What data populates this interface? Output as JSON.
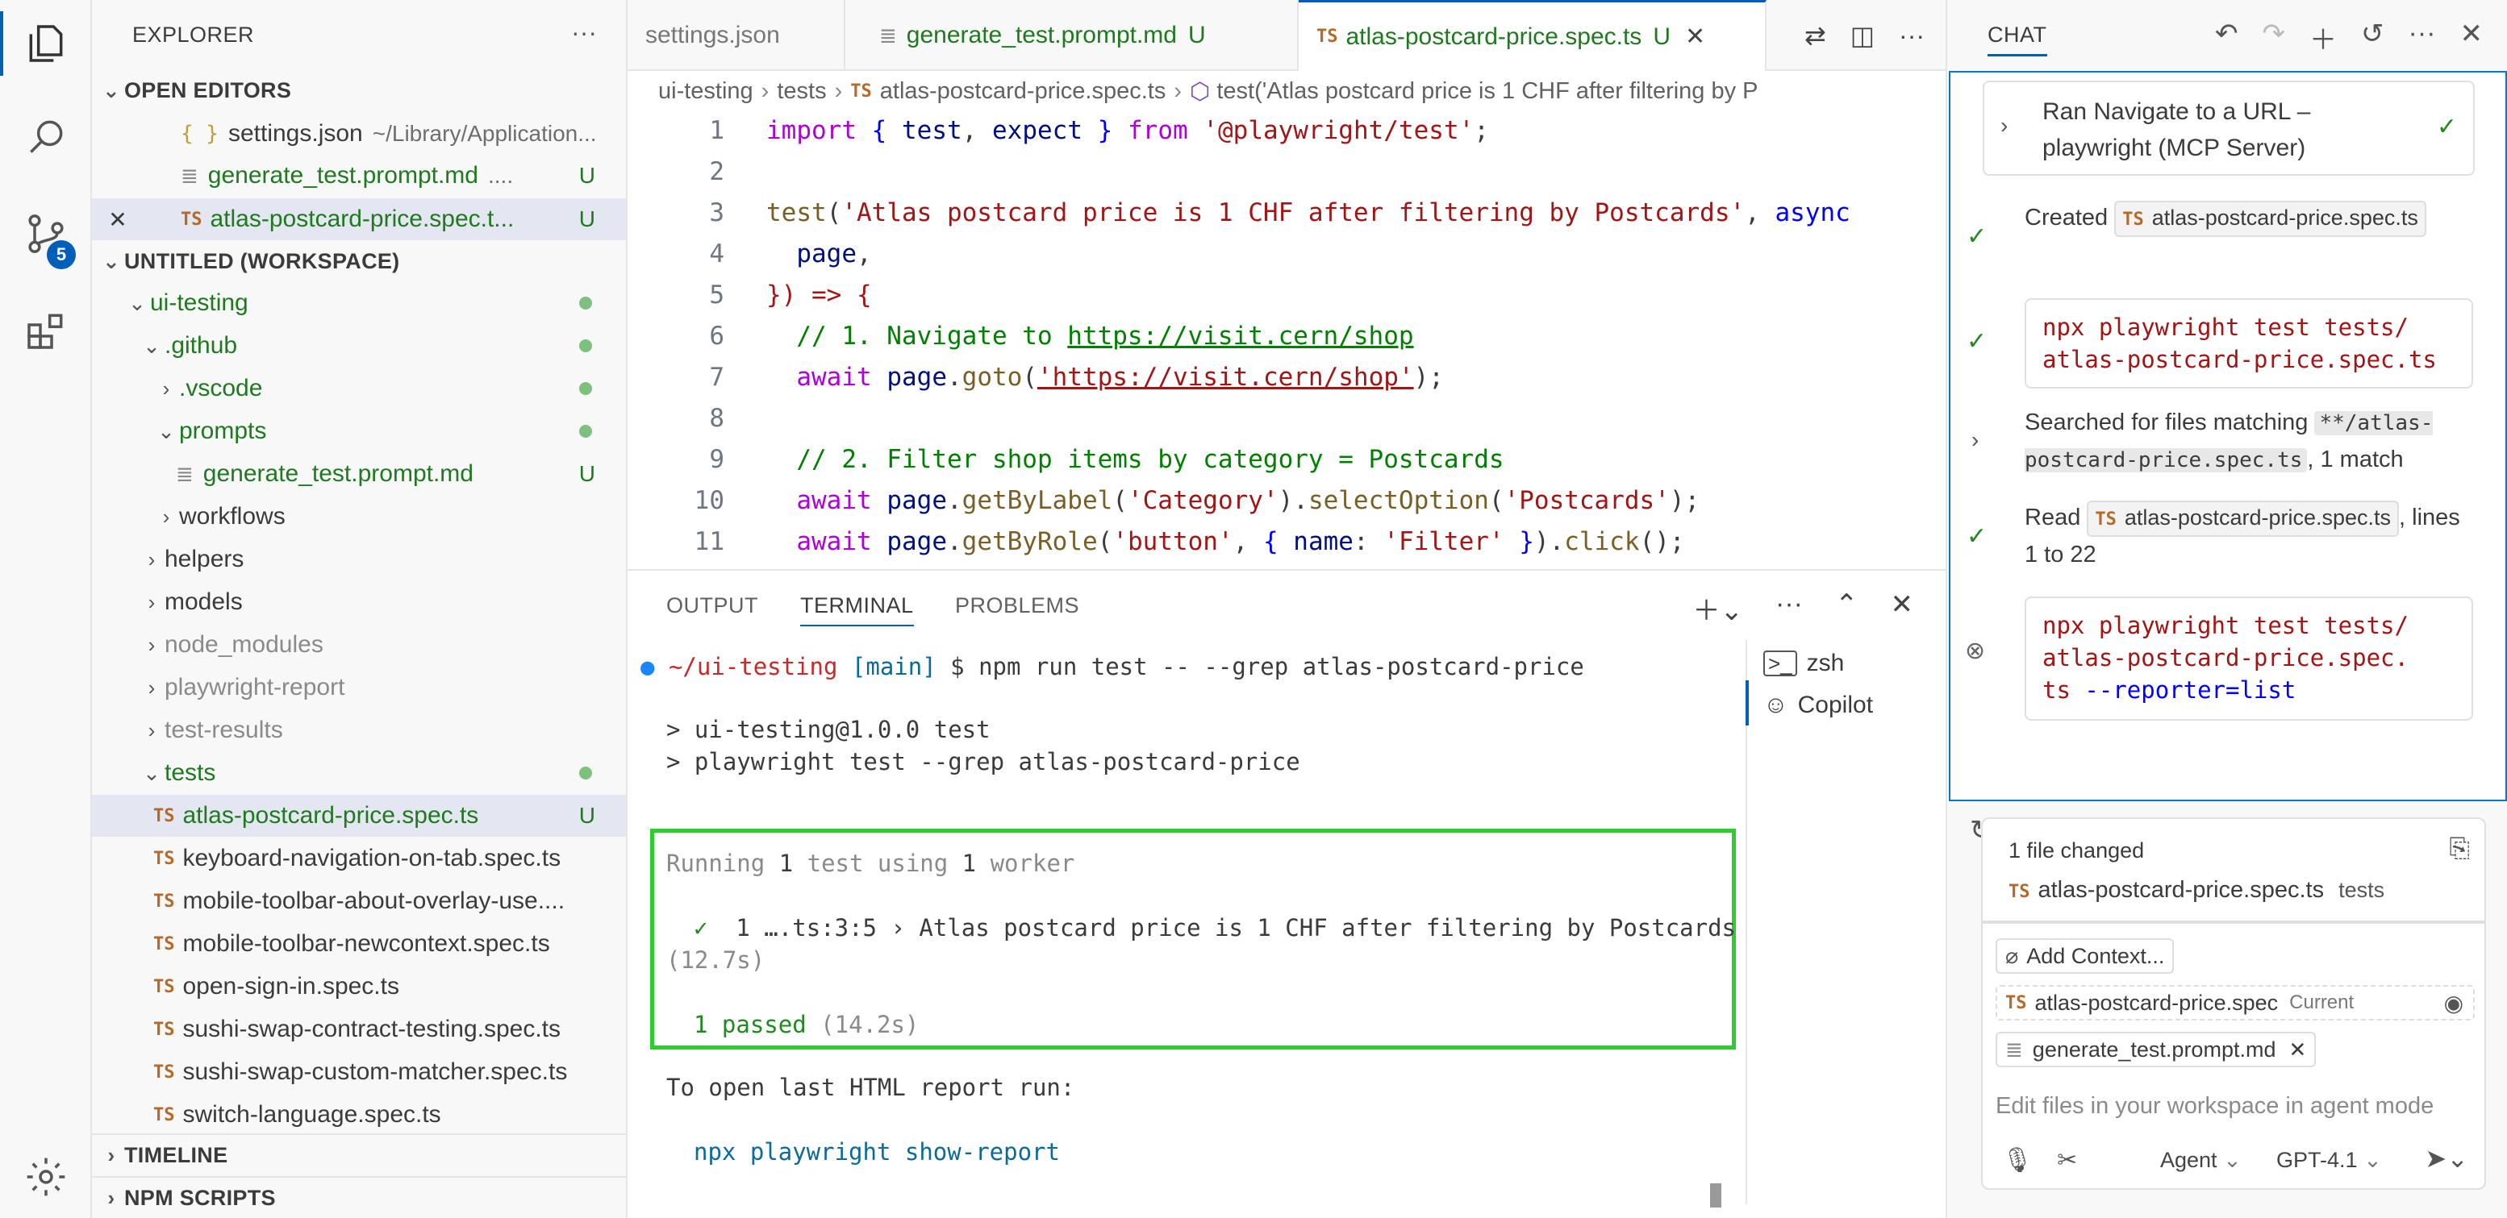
{
  "activity": {
    "badge_count": "5"
  },
  "explorer": {
    "title": "EXPLORER",
    "open_editors_label": "OPEN EDITORS",
    "open_editors": [
      {
        "name": "settings.json",
        "detail": "~/Library/Application...",
        "type": "json",
        "status": ""
      },
      {
        "name": "generate_test.prompt.md",
        "detail": "....",
        "type": "md",
        "status": "U"
      },
      {
        "name": "atlas-postcard-price.spec.t...",
        "detail": "",
        "type": "ts",
        "status": "U"
      }
    ],
    "workspace_label": "UNTITLED (WORKSPACE)",
    "tree": {
      "ui_testing": "ui-testing",
      "github": ".github",
      "vscode": ".vscode",
      "prompts": "prompts",
      "prompt_file": "generate_test.prompt.md",
      "prompt_status": "U",
      "workflows": "workflows",
      "helpers": "helpers",
      "models": "models",
      "node_modules": "node_modules",
      "playwright_report": "playwright-report",
      "test_results": "test-results",
      "tests": "tests",
      "test_files": [
        {
          "name": "atlas-postcard-price.spec.ts",
          "status": "U"
        },
        {
          "name": "keyboard-navigation-on-tab.spec.ts",
          "status": ""
        },
        {
          "name": "mobile-toolbar-about-overlay-use....",
          "status": ""
        },
        {
          "name": "mobile-toolbar-newcontext.spec.ts",
          "status": ""
        },
        {
          "name": "open-sign-in.spec.ts",
          "status": ""
        },
        {
          "name": "sushi-swap-contract-testing.spec.ts",
          "status": ""
        },
        {
          "name": "sushi-swap-custom-matcher.spec.ts",
          "status": ""
        },
        {
          "name": "switch-language.spec.ts",
          "status": ""
        }
      ]
    },
    "timeline_label": "TIMELINE",
    "npm_label": "NPM SCRIPTS",
    "ts_icon": "TS",
    "json_icon": "{ }"
  },
  "tabs": [
    {
      "label": "settings.json",
      "status": ""
    },
    {
      "label": "generate_test.prompt.md",
      "status": "U"
    },
    {
      "label": "atlas-postcard-price.spec.ts",
      "status": "U"
    }
  ],
  "breadcrumb": {
    "parts": [
      "ui-testing",
      "tests",
      "atlas-postcard-price.spec.ts"
    ],
    "symbol": "test('Atlas postcard price is 1 CHF after filtering by P"
  },
  "code": {
    "line_numbers": [
      "1",
      "2",
      "3",
      "4",
      "5",
      "6",
      "7",
      "8",
      "9",
      "10",
      "11"
    ],
    "l1": {
      "kw1": "import",
      "b1": "{",
      "v1": "test",
      "c1": ",",
      "v2": "expect",
      "b2": "}",
      "kw2": "from",
      "s1": "'@playwright/test'",
      "e": ";"
    },
    "l3": {
      "fn": "test",
      "p": "(",
      "s": "'Atlas postcard price is 1 CHF after filtering by Postcards'",
      "c": ",",
      "kw": "async"
    },
    "l4": {
      "v": "page",
      "c": ","
    },
    "l5": {
      "t": "}) => {"
    },
    "l6": {
      "c": "// 1. Navigate to ",
      "u": "https://visit.cern/shop"
    },
    "l7": {
      "kw": "await",
      "v": "page",
      "fn": "goto",
      "s": "'https://visit.cern/shop'",
      "e": ");"
    },
    "l9": {
      "c": "// 2. Filter shop items by category = Postcards"
    },
    "l10": {
      "kw": "await",
      "v": "page",
      "fn1": "getByLabel",
      "s1": "'Category'",
      "fn2": "selectOption",
      "s2": "'Postcards'",
      "e": ");"
    },
    "l11": {
      "kw": "await",
      "v": "page",
      "fn1": "getByRole",
      "s1": "'button'",
      "k": "name",
      "s2": "'Filter'",
      "fn2": "click",
      "e": "();"
    }
  },
  "panel": {
    "tabs": [
      "OUTPUT",
      "TERMINAL",
      "PROBLEMS"
    ],
    "prompt_dir": "~/ui-testing",
    "prompt_branch": "[main]",
    "prompt_cmd": "$ npm run test -- --grep atlas-postcard-price",
    "out1": "> ui-testing@1.0.0 test",
    "out2": "> playwright test --grep atlas-postcard-price",
    "running": {
      "a": "Running ",
      "n1": "1",
      "b": " test using ",
      "n2": "1",
      "c": " worker"
    },
    "result_line": "1 ….ts:3:5 › Atlas postcard price is 1 CHF after filtering by Postcards",
    "result_mark": "✓",
    "duration": "(12.7s)",
    "passed": "1 passed",
    "passed_time": "(14.2s)",
    "report_hint": "To open last HTML report run:",
    "report_cmd": "npx playwright show-report",
    "terminals": [
      "zsh",
      "Copilot"
    ]
  },
  "chat": {
    "title": "CHAT",
    "ran_tool": "Ran Navigate to a URL – playwright (MCP Server)",
    "created_label": "Created",
    "created_file": "atlas-postcard-price.spec.ts",
    "cmd1": "npx playwright test tests/\natlas-postcard-price.spec.ts",
    "searched_prefix": "Searched for files matching",
    "searched_pattern": "**/atlas-postcard-price.spec.ts",
    "searched_suffix": ", 1 match",
    "read_label": "Read",
    "read_file": "atlas-postcard-price.spec.ts",
    "read_suffix": ", lines 1 to 22",
    "cmd2_npx": "npx playwright test tests/",
    "cmd2_file1": "atlas-postcard-price.spec.",
    "cmd2_file2": "ts",
    "cmd2_flag": "--reporter=list",
    "files_changed": "1 file changed",
    "changed_file": "atlas-postcard-price.spec.ts",
    "changed_dir": "tests",
    "add_context": "Add Context...",
    "ctx_file": "atlas-postcard-price.spec",
    "ctx_current": "Current",
    "ctx_prompt": "generate_test.prompt.md",
    "input_placeholder": "Edit files in your workspace in agent mode",
    "mode": "Agent",
    "model": "GPT-4.1"
  }
}
